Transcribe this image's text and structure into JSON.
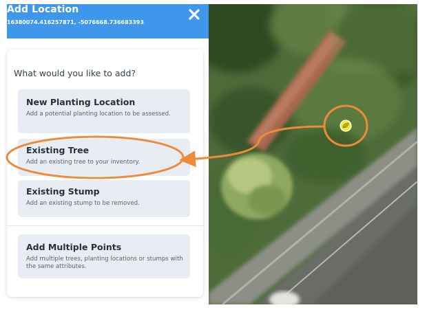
{
  "header": {
    "title": "Add Location",
    "coordinates": "16380074.416257871, -5076668.736683393",
    "close_icon": "close-icon"
  },
  "prompt": "What would you like to add?",
  "options": [
    {
      "title": "New Planting Location",
      "description": "Add a potential planting location to be assessed."
    },
    {
      "title": "Existing Tree",
      "description": "Add an existing tree to your inventory."
    },
    {
      "title": "Existing Stump",
      "description": "Add an existing stump to be removed."
    },
    {
      "title": "Add Multiple Points",
      "description": "Add multiple trees, planting locations or stumps with the same attributes."
    }
  ],
  "map": {
    "marker_icon": "leaf-location-marker-icon"
  },
  "colors": {
    "header": "#3f97ec",
    "option_bg": "#e8edf3",
    "annotation": "#ef8a3c",
    "marker": "#f4ec3a"
  }
}
